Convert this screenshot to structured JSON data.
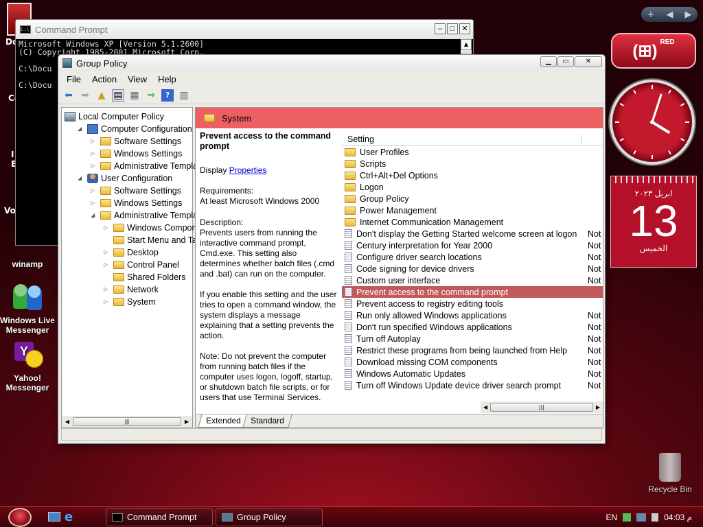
{
  "desktop": {
    "icons": [
      {
        "label": "winamp"
      },
      {
        "label": "Windows Live Messenger"
      },
      {
        "label": "Yahoo! Messenger"
      },
      {
        "label": "Recycle Bin"
      }
    ],
    "partial_labels": [
      "Do",
      "Co",
      "I",
      "E",
      "Vo"
    ]
  },
  "cmd": {
    "title": "Command Prompt",
    "lines": [
      "Microsoft Windows XP [Version 5.1.2600]",
      "(C) Copyright 1985-2001 Microsoft Corp.",
      "",
      "C:\\Docu",
      "",
      "C:\\Docu"
    ]
  },
  "gp": {
    "title": "Group Policy",
    "menu": [
      "File",
      "Action",
      "View",
      "Help"
    ],
    "tree": [
      {
        "label": "Local Computer Policy",
        "level": 0,
        "icon": "policy"
      },
      {
        "label": "Computer Configuration",
        "level": 1,
        "icon": "computer",
        "exp": "open"
      },
      {
        "label": "Software Settings",
        "level": 2,
        "icon": "folder",
        "exp": "closed"
      },
      {
        "label": "Windows Settings",
        "level": 2,
        "icon": "folder",
        "exp": "closed"
      },
      {
        "label": "Administrative Template",
        "level": 2,
        "icon": "folder",
        "exp": "closed"
      },
      {
        "label": "User Configuration",
        "level": 1,
        "icon": "user",
        "exp": "open"
      },
      {
        "label": "Software Settings",
        "level": 2,
        "icon": "folder",
        "exp": "closed"
      },
      {
        "label": "Windows Settings",
        "level": 2,
        "icon": "folder",
        "exp": "closed"
      },
      {
        "label": "Administrative Template",
        "level": 2,
        "icon": "folder",
        "exp": "open"
      },
      {
        "label": "Windows Componer",
        "level": 3,
        "icon": "folder",
        "exp": "closed"
      },
      {
        "label": "Start Menu and Task",
        "level": 3,
        "icon": "folder",
        "exp": ""
      },
      {
        "label": "Desktop",
        "level": 3,
        "icon": "folder",
        "exp": "closed"
      },
      {
        "label": "Control Panel",
        "level": 3,
        "icon": "folder",
        "exp": "closed"
      },
      {
        "label": "Shared Folders",
        "level": 3,
        "icon": "folder",
        "exp": ""
      },
      {
        "label": "Network",
        "level": 3,
        "icon": "folder",
        "exp": "closed"
      },
      {
        "label": "System",
        "level": 3,
        "icon": "folder",
        "exp": "closed"
      }
    ],
    "header": "System",
    "desc": {
      "title": "Prevent access to the command prompt",
      "display_prefix": "Display ",
      "display_link": "Properties",
      "requirements": "Requirements:",
      "requirements_text": "At least Microsoft Windows 2000",
      "description_label": "Description:",
      "p1": "Prevents users from running the interactive command prompt, Cmd.exe. This setting also determines whether batch files (.cmd and .bat) can run on the computer.",
      "p2": "If you enable this setting and the user tries to open a command window, the system displays a message explaining that a setting prevents the action.",
      "p3": "Note: Do not prevent the computer from running batch files if the computer uses logon, logoff, startup, or shutdown batch file scripts, or for users that use Terminal Services."
    },
    "column_setting": "Setting",
    "rows": [
      {
        "label": "User Profiles",
        "type": "folder",
        "state": ""
      },
      {
        "label": "Scripts",
        "type": "folder",
        "state": ""
      },
      {
        "label": "Ctrl+Alt+Del Options",
        "type": "folder",
        "state": ""
      },
      {
        "label": "Logon",
        "type": "folder",
        "state": ""
      },
      {
        "label": "Group Policy",
        "type": "folder",
        "state": ""
      },
      {
        "label": "Power Management",
        "type": "folder",
        "state": ""
      },
      {
        "label": "Internet Communication Management",
        "type": "folder",
        "state": ""
      },
      {
        "label": "Don't display the Getting Started welcome screen at logon",
        "type": "setting",
        "state": "Not"
      },
      {
        "label": "Century interpretation for Year 2000",
        "type": "setting",
        "state": "Not"
      },
      {
        "label": "Configure driver search locations",
        "type": "setting",
        "state": "Not"
      },
      {
        "label": "Code signing for device drivers",
        "type": "setting",
        "state": "Not"
      },
      {
        "label": "Custom user interface",
        "type": "setting",
        "state": "Not"
      },
      {
        "label": "Prevent access to the command prompt",
        "type": "setting",
        "state": "",
        "selected": true
      },
      {
        "label": "Prevent access to registry editing tools",
        "type": "setting",
        "state": ""
      },
      {
        "label": "Run only allowed Windows applications",
        "type": "setting",
        "state": "Not"
      },
      {
        "label": "Don't run specified Windows applications",
        "type": "setting",
        "state": "Not"
      },
      {
        "label": "Turn off Autoplay",
        "type": "setting",
        "state": "Not"
      },
      {
        "label": "Restrict these programs from being launched from Help",
        "type": "setting",
        "state": "Not"
      },
      {
        "label": "Download missing COM components",
        "type": "setting",
        "state": "Not"
      },
      {
        "label": "Windows Automatic Updates",
        "type": "setting",
        "state": "Not"
      },
      {
        "label": "Turn off Windows Update device driver search prompt",
        "type": "setting",
        "state": "Not"
      }
    ],
    "tabs": [
      "Extended",
      "Standard"
    ]
  },
  "gadgets": {
    "badge": "RED",
    "clock": {
      "hour": 4,
      "minute": 3
    },
    "calendar": {
      "month": "ابريل ٢٠٢٣",
      "day": "13",
      "weekday": "الخميس"
    }
  },
  "taskbar": {
    "buttons": [
      "Command Prompt",
      "Group Policy"
    ],
    "lang": "EN",
    "time": "04:03 م"
  },
  "colors": {
    "accent": "#c2595b",
    "header": "#ee5f61",
    "desktop": "#5a0610"
  }
}
